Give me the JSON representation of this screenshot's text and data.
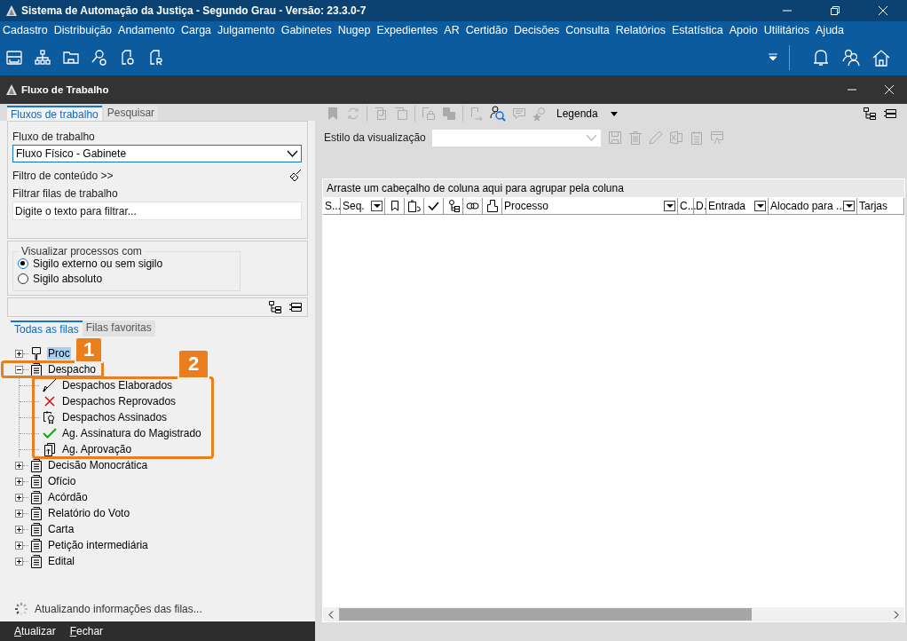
{
  "window": {
    "title": "Sistema de Automação da Justiça - Segundo Grau - Versão: 23.3.0-7"
  },
  "menu": [
    "Cadastro",
    "Distribuição",
    "Andamento",
    "Carga",
    "Julgamento",
    "Gabinetes",
    "Nugep",
    "Expedientes",
    "AR",
    "Certidão",
    "Decisões",
    "Consulta",
    "Relatórios",
    "Estatística",
    "Apoio",
    "Utilitários",
    "Ajuda"
  ],
  "subwindow": {
    "title": "Fluxo de Trabalho"
  },
  "left_tabs": [
    {
      "label": "Fluxos de trabalho",
      "selected": true
    },
    {
      "label": "Pesquisar",
      "selected": false
    }
  ],
  "workflow": {
    "label": "Fluxo de trabalho",
    "value": "Fluxo Físico - Gabinete"
  },
  "content_filter": "Filtro de conteúdo >>",
  "queue_filter": {
    "label": "Filtrar filas de trabalho",
    "placeholder": "Digite o texto para filtrar..."
  },
  "visibility": {
    "legend": "Visualizar processos com",
    "options": [
      {
        "label": "Sigilo externo ou sem sigilo",
        "selected": true
      },
      {
        "label": "Sigilo absoluto",
        "selected": false
      }
    ]
  },
  "queue_tabs": [
    {
      "label": "Todas as filas",
      "selected": true
    },
    {
      "label": "Filas favoritas",
      "selected": false
    }
  ],
  "tree": [
    {
      "label": "Proc",
      "kind": "doc",
      "expanded": false,
      "selected": true
    },
    {
      "label": "Despacho",
      "kind": "clipboard",
      "expanded": true,
      "selected": false,
      "children": [
        {
          "label": "Despachos Elaborados",
          "kind": "pen"
        },
        {
          "label": "Despachos Reprovados",
          "kind": "cross"
        },
        {
          "label": "Despachos Assinados",
          "kind": "seal"
        },
        {
          "label": "Ag. Assinatura do Magistrado",
          "kind": "check"
        },
        {
          "label": "Ag.  Aprovação",
          "kind": "approve"
        }
      ]
    },
    {
      "label": "Decisão Monocrática",
      "kind": "clipboard",
      "expanded": false,
      "selected": false
    },
    {
      "label": "Ofício",
      "kind": "clipboard",
      "expanded": false,
      "selected": false
    },
    {
      "label": "Acórdão",
      "kind": "clipboard",
      "expanded": false,
      "selected": false
    },
    {
      "label": "Relatório do Voto",
      "kind": "clipboard",
      "expanded": false,
      "selected": false
    },
    {
      "label": "Carta",
      "kind": "clipboard",
      "expanded": false,
      "selected": false
    },
    {
      "label": "Petição intermediária",
      "kind": "clipboard",
      "expanded": false,
      "selected": false
    },
    {
      "label": "Edital",
      "kind": "clipboard",
      "expanded": false,
      "selected": false
    }
  ],
  "status": "Atualizando informações das filas...",
  "buttons": [
    "Atualizar",
    "Fechar"
  ],
  "legend_button": "Legenda",
  "view_style": {
    "label": "Estilo da visualização"
  },
  "group_hint": "Arraste um cabeçalho de coluna aqui para agrupar pela coluna",
  "columns": [
    {
      "label": "S...",
      "filter": false
    },
    {
      "label": "Seq.",
      "filter": true
    },
    {
      "label": "Processo",
      "filter": true
    },
    {
      "label": "C...",
      "filter": false
    },
    {
      "label": "D.",
      "filter": false
    },
    {
      "label": "Entrada",
      "filter": true
    },
    {
      "label": "Alocado para ...",
      "filter": true
    },
    {
      "label": "Tarjas",
      "filter": false
    }
  ],
  "callouts": [
    {
      "label": "1"
    },
    {
      "label": "2"
    }
  ]
}
